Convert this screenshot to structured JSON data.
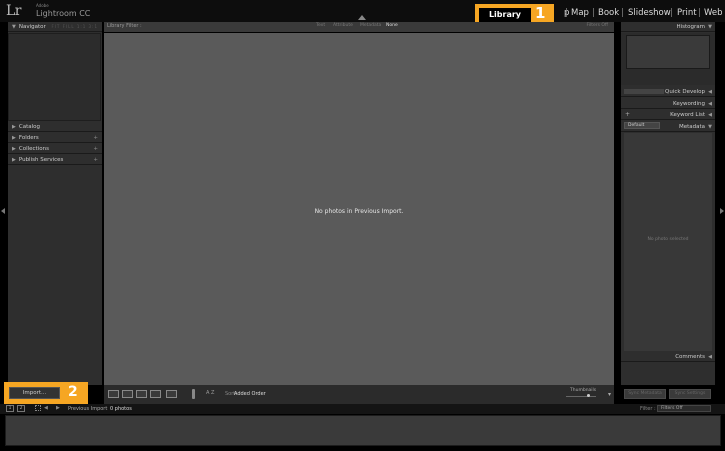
{
  "app": {
    "logo": "Lr",
    "brand_small": "Adobe",
    "brand": "Lightroom CC"
  },
  "modules": {
    "active": "Library",
    "partial": "p",
    "items": [
      "Map",
      "Book",
      "Slideshow",
      "Print",
      "Web"
    ]
  },
  "callouts": {
    "one": "1",
    "two": "2"
  },
  "left_panel": {
    "navigator": "Navigator",
    "navigator_opts": "FIT FILL 1:1 3:1",
    "catalog": "Catalog",
    "folders": "Folders",
    "collections": "Collections",
    "publish_services": "Publish Services",
    "plus": "+"
  },
  "import_button": "Import...",
  "filter_bar": {
    "label": "Library Filter :",
    "text": "Text",
    "attribute": "Attribute",
    "metadata": "Metadata",
    "none": "None",
    "preset": "Filters Off"
  },
  "grid": {
    "empty_message": "No photos in Previous Import."
  },
  "toolbar": {
    "sort_label": "Sort:",
    "sort_value": "Added Order",
    "az": "A Z",
    "thumbnails": "Thumbnails",
    "chevron": "▾"
  },
  "right_panel": {
    "histogram": "Histogram",
    "quick_develop": "Quick Develop",
    "keywording": "Keywording",
    "keyword_list": "Keyword List",
    "metadata": "Metadata",
    "metadata_preset": "Default",
    "no_photo": "No photo selected",
    "comments": "Comments",
    "sync_metadata": "Sync Metadata",
    "sync_settings": "Sync Settings",
    "plus": "+"
  },
  "filmstrip_bar": {
    "box1": "1",
    "box2": "2",
    "source": "Previous Import",
    "count": "0 photos",
    "filter_label": "Filter :",
    "filter_value": "Filters Off"
  },
  "colors": {
    "callout": "#f6a623",
    "grid_bg": "#5a5a5a",
    "panel_bg": "#2e2e2e"
  }
}
